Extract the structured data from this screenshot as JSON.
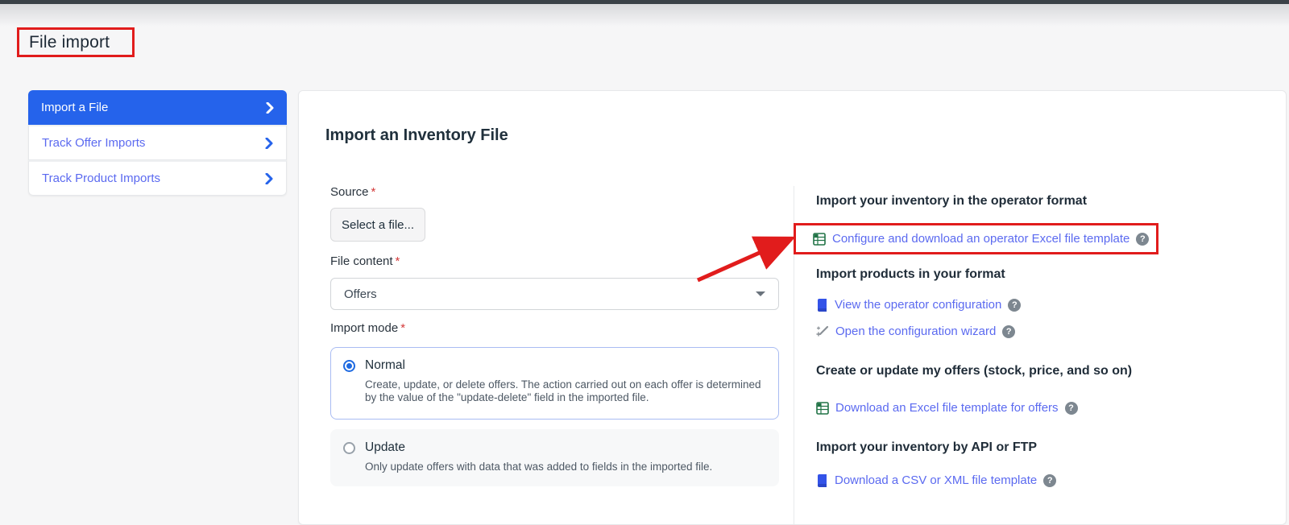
{
  "page_title": "File import",
  "sidebar": {
    "items": [
      {
        "label": "Import a File",
        "active": true
      },
      {
        "label": "Track Offer Imports",
        "active": false
      },
      {
        "label": "Track Product Imports",
        "active": false
      }
    ]
  },
  "main": {
    "heading": "Import an Inventory File",
    "form": {
      "required_marker": "*",
      "source_label": "Source",
      "select_file_button": "Select a file...",
      "file_content_label": "File content",
      "file_content_value": "Offers",
      "import_mode_label": "Import mode",
      "modes": [
        {
          "label": "Normal",
          "selected": true,
          "description": "Create, update, or delete offers. The action carried out on each offer is determined by the value of the \"update-delete\" field in the imported file."
        },
        {
          "label": "Update",
          "selected": false,
          "description": "Only update offers with data that was added to fields in the imported file."
        }
      ]
    },
    "help": {
      "sections": [
        {
          "heading": "Import your inventory in the operator format",
          "links": [
            {
              "icon": "excel-file-icon",
              "label": "Configure and download an operator Excel file template",
              "highlighted": true
            }
          ]
        },
        {
          "heading": "Import products in your format",
          "links": [
            {
              "icon": "book-icon",
              "label": "View the operator configuration"
            },
            {
              "icon": "wand-icon",
              "label": "Open the configuration wizard"
            }
          ]
        },
        {
          "heading": "Create or update my offers (stock, price, and so on)",
          "links": [
            {
              "icon": "excel-file-icon",
              "label": "Download an Excel file template for offers"
            }
          ]
        },
        {
          "heading": "Import your inventory by API or FTP",
          "links": [
            {
              "icon": "book-icon",
              "label": "Download a CSV or XML file template"
            }
          ]
        }
      ]
    }
  },
  "icons": {
    "help_glyph": "?"
  },
  "colors": {
    "accent_blue": "#2563eb",
    "link_blue": "#5b6af0",
    "annotation_red": "#e11c1c",
    "excel_green": "#217346",
    "book_blue": "#3353e8",
    "heading_dark": "#1f2c38"
  }
}
